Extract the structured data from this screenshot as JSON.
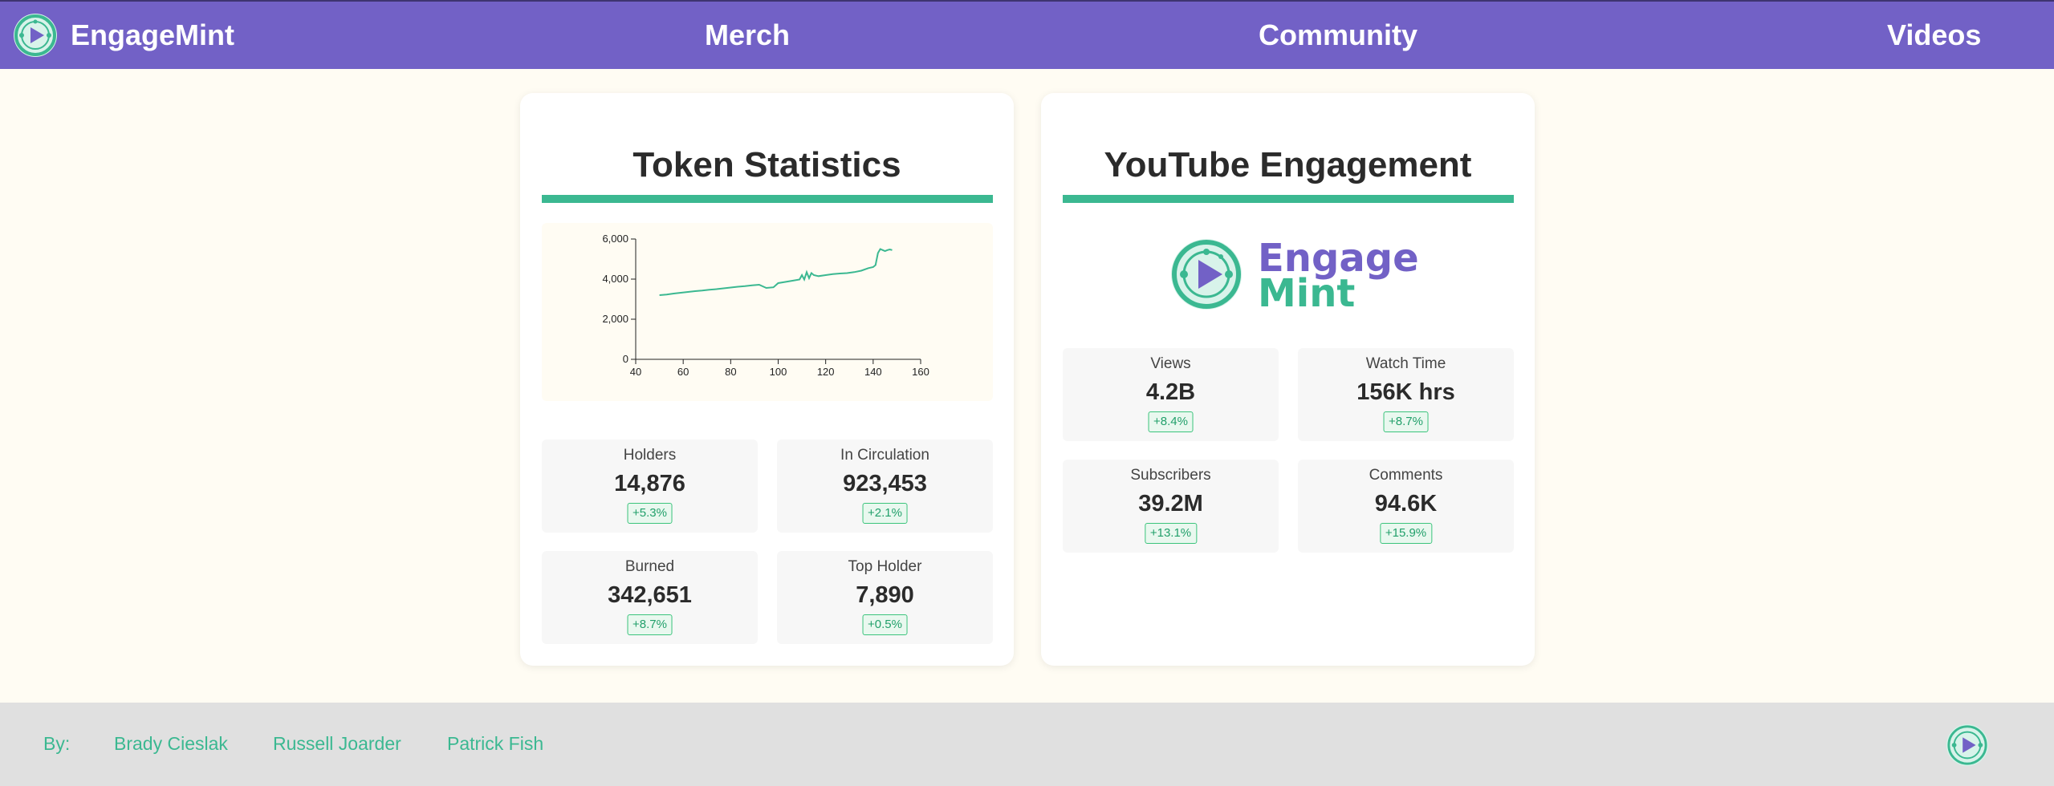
{
  "nav": {
    "brand": "EngageMint",
    "links": [
      "Merch",
      "Community",
      "Videos"
    ]
  },
  "token": {
    "title": "Token Statistics",
    "stats": [
      {
        "label": "Holders",
        "value": "14,876",
        "change": "+5.3%"
      },
      {
        "label": "In Circulation",
        "value": "923,453",
        "change": "+2.1%"
      },
      {
        "label": "Burned",
        "value": "342,651",
        "change": "+8.7%"
      },
      {
        "label": "Top Holder",
        "value": "7,890",
        "change": "+0.5%"
      }
    ]
  },
  "youtube": {
    "title": "YouTube Engagement",
    "logo_top": "Engage",
    "logo_bottom": "Mint",
    "stats": [
      {
        "label": "Views",
        "value": "4.2B",
        "change": "+8.4%"
      },
      {
        "label": "Watch Time",
        "value": "156K hrs",
        "change": "+8.7%"
      },
      {
        "label": "Subscribers",
        "value": "39.2M",
        "change": "+13.1%"
      },
      {
        "label": "Comments",
        "value": "94.6K",
        "change": "+15.9%"
      }
    ]
  },
  "footer": {
    "by_label": "By:",
    "authors": [
      "Brady Cieslak",
      "Russell Joarder",
      "Patrick Fish"
    ]
  },
  "colors": {
    "nav_bg": "#7261c6",
    "accent_green": "#3bb891",
    "page_bg": "#fffcf3",
    "footer_bg": "#e0e0e0"
  },
  "chart_data": {
    "type": "line",
    "title": "",
    "xlabel": "",
    "ylabel": "",
    "xlim": [
      40,
      160
    ],
    "ylim": [
      0,
      6000
    ],
    "x_ticks": [
      40,
      60,
      80,
      100,
      120,
      140,
      160
    ],
    "y_ticks": [
      0,
      2000,
      4000,
      6000
    ],
    "y_tick_labels": [
      "0",
      "2,000",
      "4,000",
      "6,000"
    ],
    "grid": false,
    "series": [
      {
        "color": "#3bb891",
        "x": [
          50,
          53,
          56,
          59,
          62,
          65,
          68,
          71,
          74,
          77,
          80,
          83,
          86,
          89,
          92,
          95,
          98,
          100,
          103,
          106,
          109,
          110,
          111,
          112,
          113,
          114,
          115,
          117,
          120,
          123,
          126,
          129,
          132,
          135,
          138,
          140,
          141,
          142,
          143,
          144,
          145,
          146,
          147,
          148
        ],
        "y": [
          3200,
          3230,
          3280,
          3320,
          3360,
          3400,
          3430,
          3470,
          3500,
          3540,
          3580,
          3620,
          3650,
          3690,
          3720,
          3560,
          3590,
          3800,
          3860,
          3920,
          3980,
          4200,
          3980,
          4350,
          4050,
          4300,
          4200,
          4150,
          4200,
          4250,
          4280,
          4300,
          4350,
          4420,
          4550,
          4600,
          4700,
          5300,
          5500,
          5450,
          5400,
          5450,
          5480,
          5450
        ]
      }
    ]
  }
}
